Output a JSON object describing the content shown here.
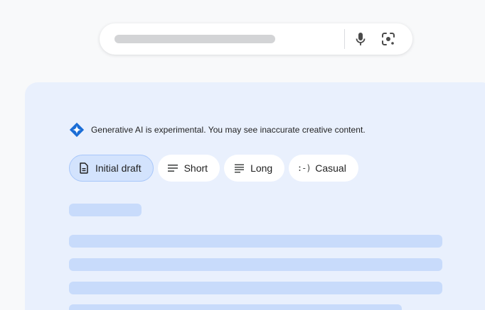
{
  "search": {
    "mic_icon": "mic-icon",
    "lens_icon": "camera-lens-icon"
  },
  "notice": {
    "icon": "gemini-sparkle-icon",
    "text": "Generative AI is experimental. You may see inaccurate creative content."
  },
  "chips": [
    {
      "label": "Initial draft",
      "icon": "document-icon",
      "selected": true
    },
    {
      "label": "Short",
      "icon": "short-text-icon",
      "selected": false
    },
    {
      "label": "Long",
      "icon": "long-text-icon",
      "selected": false
    },
    {
      "label": "Casual",
      "icon": "casual-icon",
      "casual_glyph": ":-)",
      "selected": false
    }
  ],
  "colors": {
    "page_background": "#f8f9fa",
    "panel_background": "#e9f0fd",
    "skeleton": "#c8dbfb",
    "chip_selected": "#d3e3fd",
    "accent": "#1a73e8"
  }
}
